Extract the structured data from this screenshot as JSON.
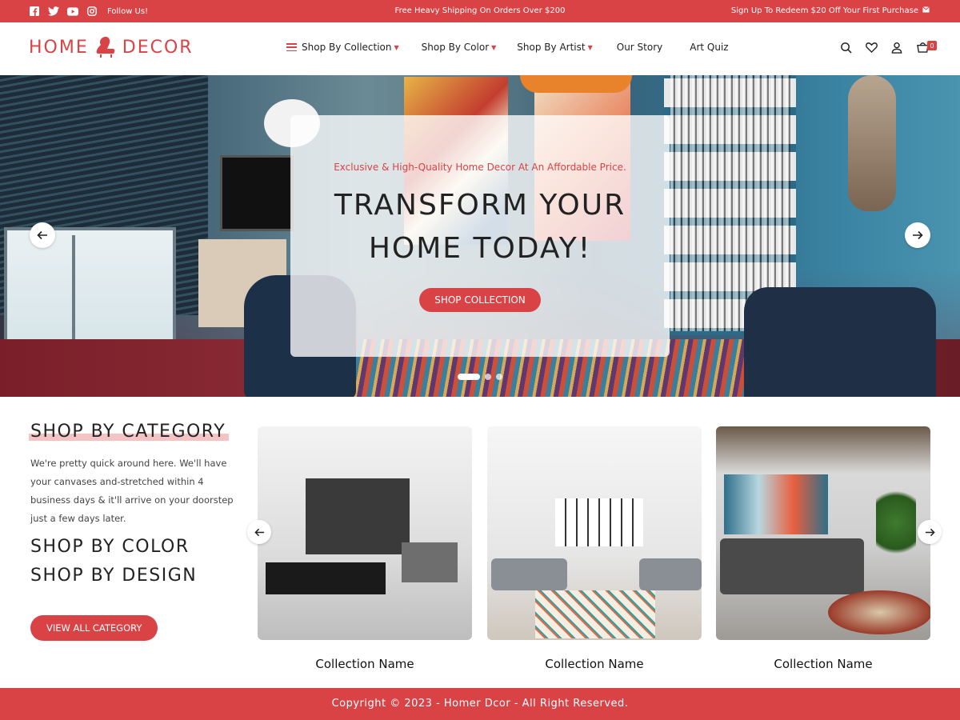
{
  "topbar": {
    "follow_text": "Follow Us!",
    "shipping_text": "Free Heavy Shipping On Orders Over $200",
    "redeem_text": "Sign Up To Redeem $20 Off Your First Purchase",
    "social_icons": [
      "facebook-icon",
      "twitter-icon",
      "youtube-icon",
      "instagram-icon"
    ]
  },
  "header": {
    "logo_left": "HOME",
    "logo_right": "DECOR",
    "nav": [
      {
        "label": "Shop By Collection",
        "has_dropdown": true
      },
      {
        "label": "Shop By Color",
        "has_dropdown": true
      },
      {
        "label": "Shop By Artist",
        "has_dropdown": true
      },
      {
        "label": "Our Story",
        "has_dropdown": false
      },
      {
        "label": "Art Quiz",
        "has_dropdown": false
      }
    ],
    "cart_count": "0"
  },
  "hero": {
    "kicker": "Exclusive & High-Quality Home Decor At An Affordable Price.",
    "headline_line1": "TRANSFORM YOUR",
    "headline_line2": "HOME TODAY!",
    "cta": "SHOP COLLECTION",
    "slide_count": 3,
    "active_slide": 1
  },
  "category": {
    "title": "SHOP BY CATEGORY",
    "description": "We're pretty quick around here. We'll have your canvases and-stretched within 4 business days & it'll arrive on your doorstep just a few days later.",
    "link_color": "SHOP BY COLOR",
    "link_design": "SHOP BY DESIGN",
    "view_all": "VIEW ALL CATEGORY",
    "collections": [
      {
        "name": "Collection Name"
      },
      {
        "name": "Collection Name"
      },
      {
        "name": "Collection Name"
      }
    ]
  },
  "footer": {
    "copyright": "Copyright © 2023 - Homer Dcor - All Right Reserved."
  },
  "colors": {
    "accent": "#d94346",
    "highlight": "#f4c3c4"
  }
}
